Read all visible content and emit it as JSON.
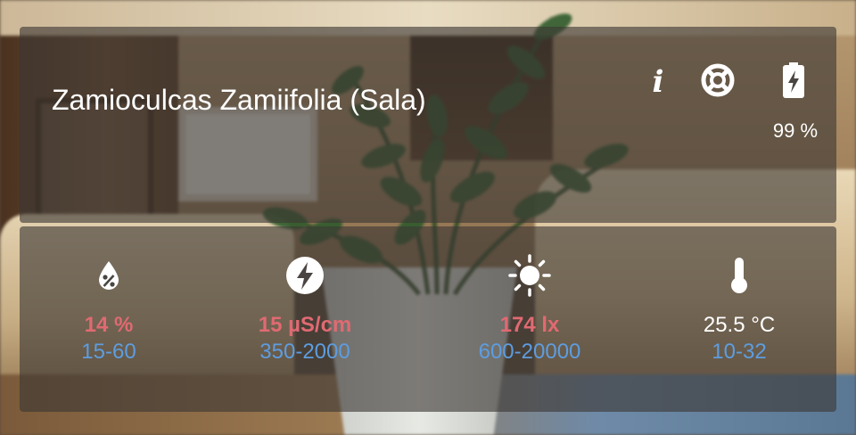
{
  "plant": {
    "title": "Zamioculcas Zamiifolia (Sala)"
  },
  "header_icons": [
    "info-icon",
    "lifebuoy-icon",
    "battery-charging-icon"
  ],
  "battery": {
    "level": "99 %"
  },
  "sensors": [
    {
      "icon": "moisture-percent-icon",
      "value": "14 %",
      "range": "15-60",
      "status": "alert"
    },
    {
      "icon": "conductivity-flash-icon",
      "value": "15 µS/cm",
      "range": "350-2000",
      "status": "alert"
    },
    {
      "icon": "sun-icon",
      "value": "174 lx",
      "range": "600-20000",
      "status": "alert"
    },
    {
      "icon": "thermometer-icon",
      "value": "25.5 °C",
      "range": "10-32",
      "status": "ok"
    }
  ],
  "colors": {
    "alert": "#e06a72",
    "range": "#5d9de0",
    "text": "#ffffff",
    "card": "rgba(60,55,52,0.62)"
  }
}
